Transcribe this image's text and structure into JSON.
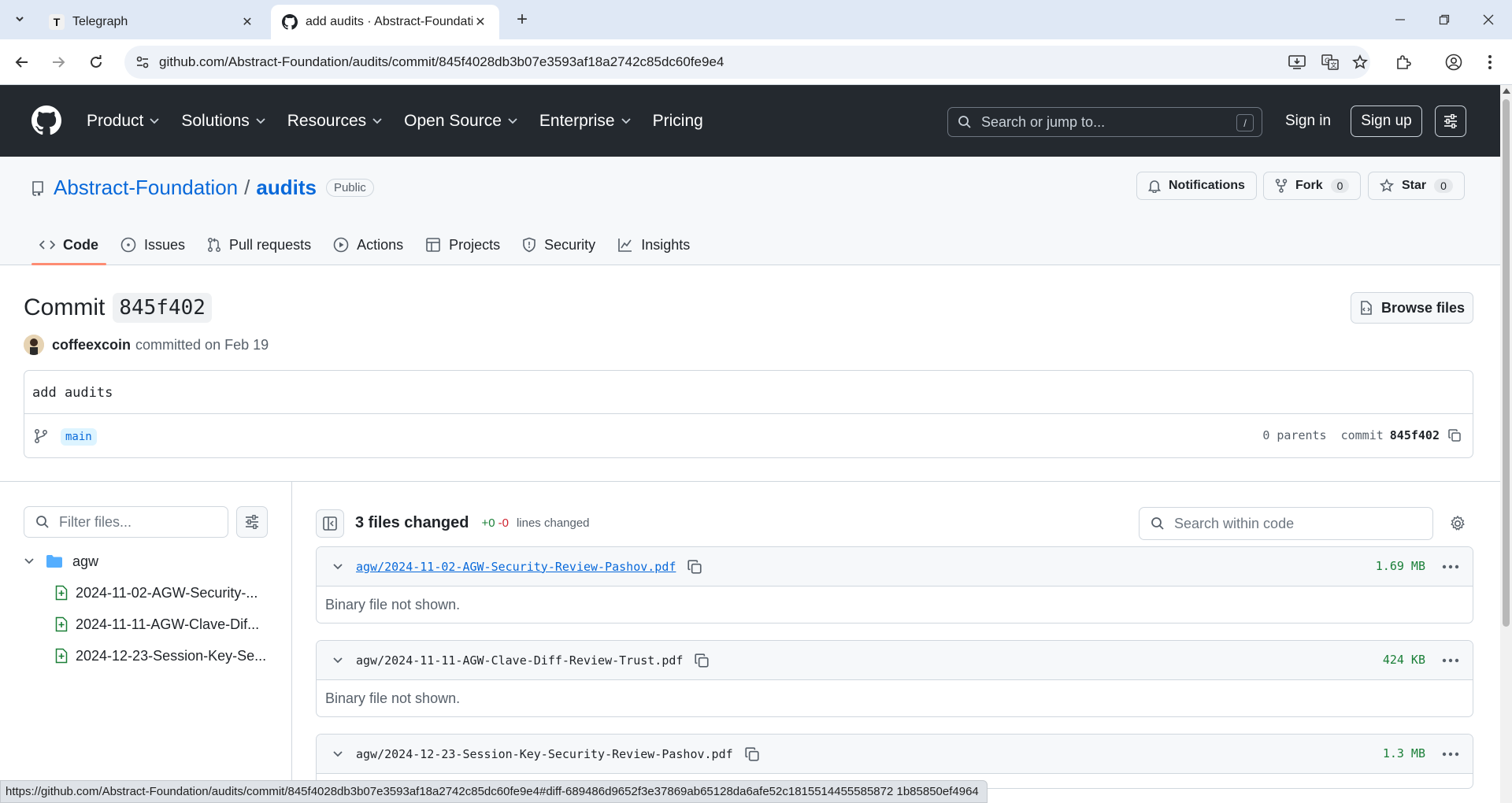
{
  "browser": {
    "tabs": [
      {
        "title": "Telegraph",
        "favicon": "T"
      },
      {
        "title": "add audits · Abstract-Foundatio"
      }
    ],
    "url": "github.com/Abstract-Foundation/audits/commit/845f4028db3b07e3593af18a2742c85dc60fe9e4",
    "status_url": "https://github.com/Abstract-Foundation/audits/commit/845f4028db3b07e3593af18a2742c85dc60fe9e4#diff-689486d9652f3e37869ab65128da6afe52c1815514455585872 1b85850ef4964"
  },
  "gh_header": {
    "nav": [
      {
        "label": "Product"
      },
      {
        "label": "Solutions"
      },
      {
        "label": "Resources"
      },
      {
        "label": "Open Source"
      },
      {
        "label": "Enterprise"
      },
      {
        "label": "Pricing"
      }
    ],
    "search_placeholder": "Search or jump to...",
    "search_kbd": "/",
    "sign_in": "Sign in",
    "sign_up": "Sign up"
  },
  "repo": {
    "owner": "Abstract-Foundation",
    "separator": "/",
    "name": "audits",
    "visibility": "Public",
    "notifications": "Notifications",
    "fork_label": "Fork",
    "fork_count": "0",
    "star_label": "Star",
    "star_count": "0",
    "tabs": [
      {
        "label": "Code"
      },
      {
        "label": "Issues"
      },
      {
        "label": "Pull requests"
      },
      {
        "label": "Actions"
      },
      {
        "label": "Projects"
      },
      {
        "label": "Security"
      },
      {
        "label": "Insights"
      }
    ]
  },
  "commit": {
    "title_prefix": "Commit",
    "sha_short": "845f402",
    "browse_files": "Browse files",
    "author": "coffeexcoin",
    "committed_text": "committed on Feb 19",
    "message": "add audits",
    "branch": "main",
    "parents": "0 parents",
    "commit_label": "commit"
  },
  "files_sidebar": {
    "filter_placeholder": "Filter files...",
    "folder": "agw",
    "files": [
      "2024-11-02-AGW-Security-...",
      "2024-11-11-AGW-Clave-Dif...",
      "2024-12-23-Session-Key-Se..."
    ]
  },
  "diff": {
    "files_changed": "3 files changed",
    "additions": "+0",
    "deletions": "-0",
    "lines_changed": "lines changed",
    "search_placeholder": "Search within code",
    "files": [
      {
        "path": "agw/2024-11-02-AGW-Security-Review-Pashov.pdf",
        "size": "1.69 MB",
        "body": "Binary file not shown."
      },
      {
        "path": "agw/2024-11-11-AGW-Clave-Diff-Review-Trust.pdf",
        "size": "424 KB",
        "body": "Binary file not shown."
      },
      {
        "path": "agw/2024-12-23-Session-Key-Security-Review-Pashov.pdf",
        "size": "1.3 MB",
        "body": ""
      }
    ]
  }
}
